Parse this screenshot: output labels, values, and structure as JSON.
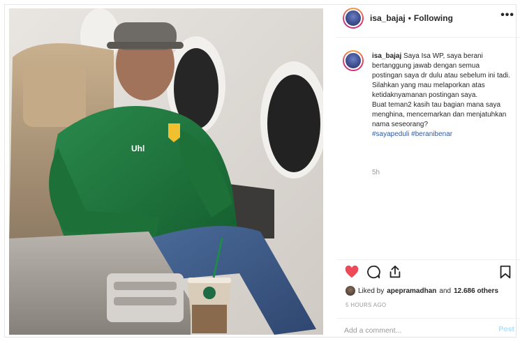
{
  "post": {
    "username": "isa_bajaj",
    "separator": "•",
    "follow_state": "Following",
    "more_icon": "more-horizontal-icon"
  },
  "caption": {
    "username": "isa_bajaj",
    "lines": [
      "Saya Isa WP, saya berani bertanggung jawab dengan semua postingan saya dr dulu atau sebelum ini tadi.",
      "Silahkan yang mau melaporkan atas ketidaknyamanan postingan saya.",
      "Buat teman2 kasih tau bagian mana saya menghina, mencemarkan dan menjatuhkan nama seseorang?"
    ],
    "hashtags": "#sayapeduli #beranibenar",
    "time_ago": "5h"
  },
  "actions": {
    "like_icon": "heart-filled-icon",
    "comment_icon": "comment-icon",
    "share_icon": "share-icon",
    "save_icon": "bookmark-icon",
    "like_color": "#ed4956"
  },
  "likes": {
    "prefix": "Liked by",
    "liker": "apepramadhan",
    "and": "and",
    "count": "12.686 others"
  },
  "timestamp": "5 HOURS AGO",
  "comment_box": {
    "placeholder": "Add a comment...",
    "post_label": "Post"
  },
  "photo": {
    "jacket_logo": "Uhl"
  }
}
